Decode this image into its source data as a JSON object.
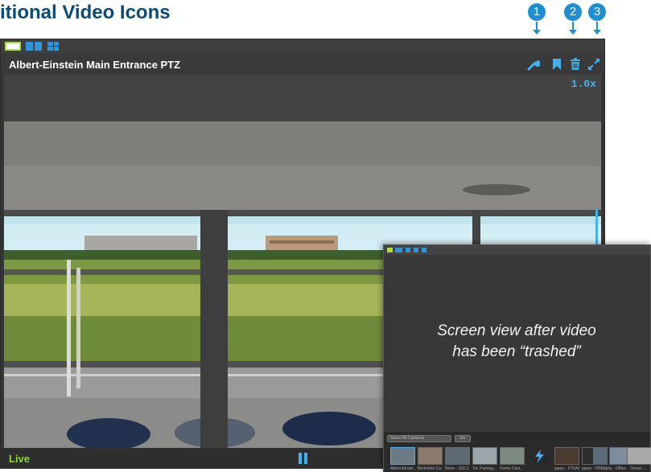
{
  "page": {
    "heading": "itional Video Icons"
  },
  "callouts": [
    "1",
    "2",
    "3"
  ],
  "window": {
    "camera_title": "Albert-Einstein Main Entrance PTZ",
    "zoom_level": "1.0x",
    "status": "Live",
    "icons": [
      "wrench-icon",
      "bookmark-icon",
      "trash-icon",
      "fullscreen-icon",
      "pause-icon"
    ]
  },
  "inset": {
    "message_line1": "Screen view after video",
    "message_line2": "has been “trashed”",
    "filter_label": "Select All Cameras",
    "go_label": "Go",
    "thumbnails": [
      "Albert-Einste...",
      "Berkshire Ca...",
      "Notre - SSC1",
      "Tst. Parking...",
      "Home Cam...",
      "",
      "",
      "japan - FTSA8",
      "japan - PRO...",
      "Lobby",
      "Office",
      "Ocean ..."
    ]
  },
  "colors": {
    "accent": "#3fb3f0",
    "live": "#8cd43a",
    "callout": "#1f8fd4",
    "heading": "#0c4a7a"
  }
}
